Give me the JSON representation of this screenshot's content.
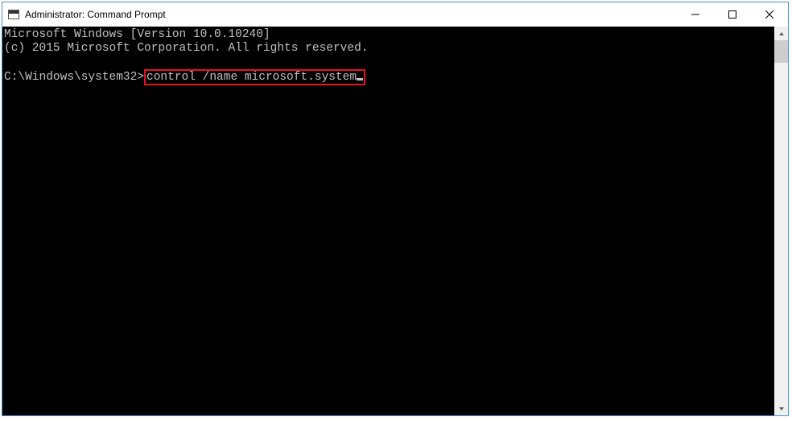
{
  "titlebar": {
    "title": "Administrator: Command Prompt"
  },
  "terminal": {
    "line1": "Microsoft Windows [Version 10.0.10240]",
    "line2": "(c) 2015 Microsoft Corporation. All rights reserved.",
    "prompt": "C:\\Windows\\system32>",
    "command": "control /name microsoft.system"
  },
  "highlight": {
    "color": "#e81123"
  }
}
